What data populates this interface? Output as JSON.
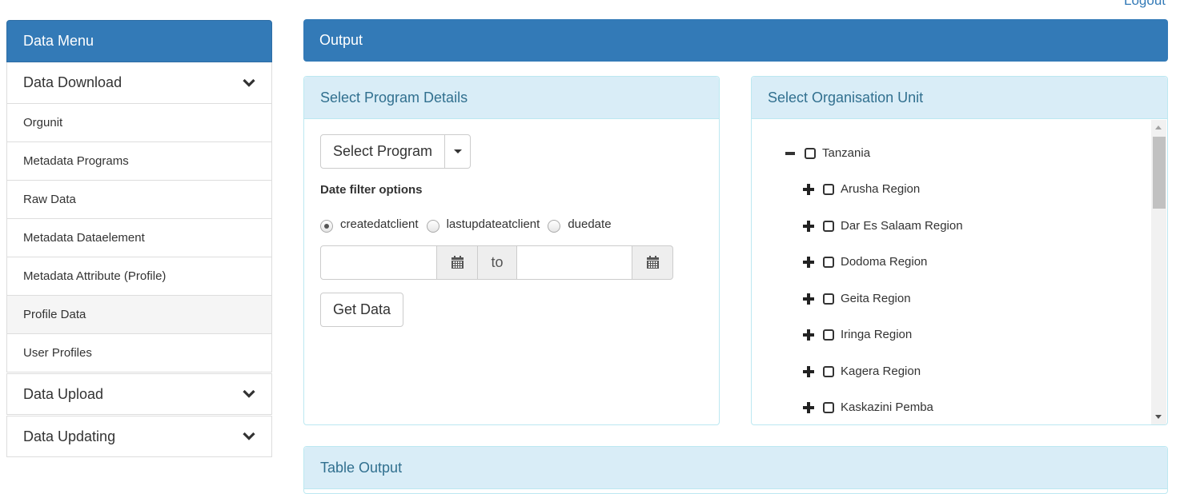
{
  "header": {
    "logout_label": "Logout"
  },
  "sidebar": {
    "title": "Data Menu",
    "groups": [
      {
        "label": "Data Download"
      },
      {
        "label": "Data Upload"
      },
      {
        "label": "Data Updating"
      }
    ],
    "items": [
      {
        "label": "Orgunit"
      },
      {
        "label": "Metadata Programs"
      },
      {
        "label": "Raw Data"
      },
      {
        "label": "Metadata Dataelement"
      },
      {
        "label": "Metadata Attribute (Profile)"
      },
      {
        "label": "Profile Data"
      },
      {
        "label": "User Profiles"
      }
    ],
    "active_item": "Profile Data"
  },
  "output": {
    "title": "Output"
  },
  "program_panel": {
    "title": "Select Program Details",
    "select_label": "Select Program",
    "filter_title": "Date filter options",
    "radios": [
      {
        "label": "createdatclient",
        "checked": true
      },
      {
        "label": "lastupdateatclient",
        "checked": false
      },
      {
        "label": "duedate",
        "checked": false
      }
    ],
    "date_from": "",
    "date_to": "",
    "to_label": "to",
    "get_data_label": "Get Data"
  },
  "org_panel": {
    "title": "Select Organisation Unit",
    "root": {
      "label": "Tanzania",
      "expanded": true
    },
    "children": [
      {
        "label": "Arusha Region"
      },
      {
        "label": "Dar Es Salaam Region"
      },
      {
        "label": "Dodoma Region"
      },
      {
        "label": "Geita Region"
      },
      {
        "label": "Iringa Region"
      },
      {
        "label": "Kagera Region"
      },
      {
        "label": "Kaskazini Pemba"
      }
    ]
  },
  "table_output": {
    "title": "Table Output"
  },
  "colors": {
    "primary": "#337ab7",
    "info_bg": "#d9edf7",
    "info_text": "#31708f",
    "info_border": "#bce8f1"
  }
}
